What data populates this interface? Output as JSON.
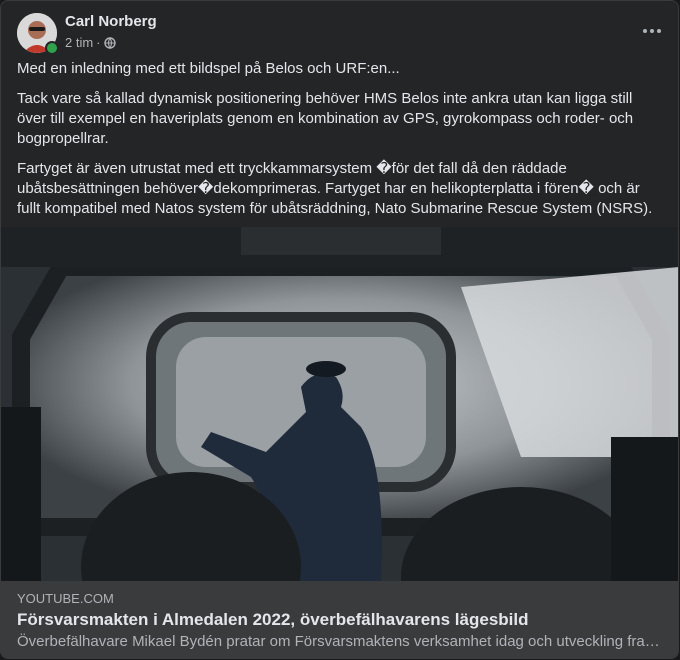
{
  "post": {
    "author": "Carl Norberg",
    "time": "2 tim",
    "separator": "·",
    "paragraphs": [
      "Med en inledning med ett bildspel på Belos och URF:en...",
      "Tack vare så kallad dynamisk positionering behöver HMS Belos inte ankra utan kan ligga still över till exempel en haveriplats genom en kombination av GPS, gyrokompass och roder- och bogpropellrar.",
      "Fartyget är även utrustat med ett tryckkammarsystem �för det fall då den räddade ubåtsbesättningen behöver�dekomprimeras. Fartyget har en helikopterplatta i fören� och är fullt kompatibel med Natos system för ubåtsräddning, Nato Submarine Rescue System (NSRS)."
    ]
  },
  "link_preview": {
    "domain": "YOUTUBE.COM",
    "title": "Försvarsmakten i Almedalen 2022, överbefälhavarens lägesbild",
    "description": "Överbefälhavare Mikael Bydén pratar om Försvarsmaktens verksamhet idag och utveckling framöver."
  },
  "icons": {
    "globe": "globe-icon",
    "more": "more-horizontal-icon",
    "avatar": "avatar"
  },
  "colors": {
    "card_bg": "#242526",
    "text": "#e4e6eb",
    "secondary": "#b0b3b8",
    "online": "#31a24c"
  }
}
